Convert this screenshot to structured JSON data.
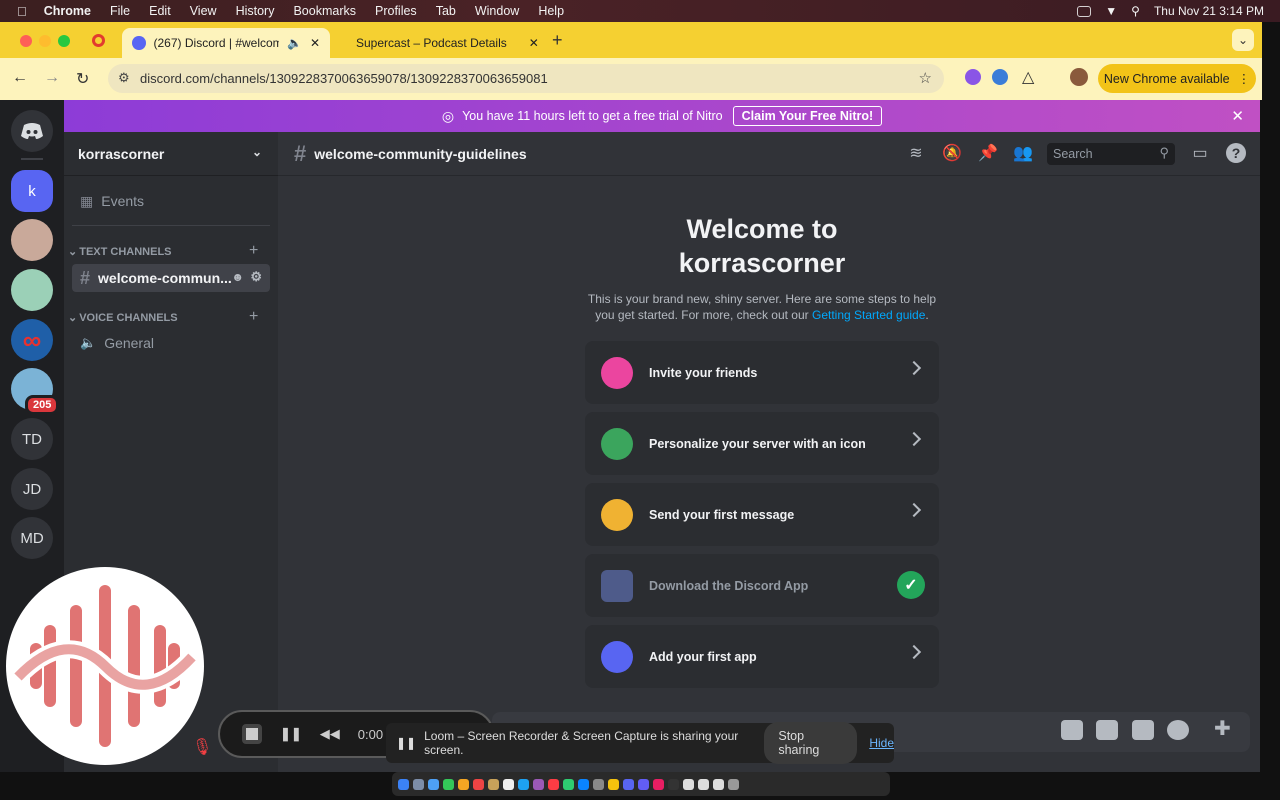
{
  "menubar": {
    "app": "Chrome",
    "items": [
      "File",
      "Edit",
      "View",
      "History",
      "Bookmarks",
      "Profiles",
      "Tab",
      "Window",
      "Help"
    ],
    "clock": "Thu Nov 21  3:14 PM"
  },
  "browser": {
    "tabs": [
      {
        "title": "(267) Discord | #welcome",
        "badge": "267"
      },
      {
        "title": "Supercast – Podcast Details"
      }
    ],
    "url": "discord.com/channels/1309228370063659078/1309228370063659081",
    "new_chrome": "New Chrome available"
  },
  "nitro": {
    "text": "You have 11 hours left to get a free trial of Nitro",
    "claim": "Claim Your Free Nitro!"
  },
  "guilds": {
    "selected_initial": "k",
    "badge": "205",
    "initials": [
      "TD",
      "JD",
      "MD"
    ]
  },
  "server": {
    "name": "korrascorner",
    "events": "Events",
    "text_category": "TEXT CHANNELS",
    "voice_category": "VOICE CHANNELS",
    "text_channel": "welcome-commun...",
    "voice_channel": "General"
  },
  "channel": {
    "name": "welcome-community-guidelines",
    "search_placeholder": "Search"
  },
  "welcome": {
    "title_line1": "Welcome to",
    "title_line2": "korrascorner",
    "desc": "This is your brand new, shiny server. Here are some steps to help you get started. For more, check out our",
    "link": "Getting Started guide",
    "cards": [
      "Invite your friends",
      "Personalize your server with an icon",
      "Send your first message",
      "Download the Discord App",
      "Add your first app"
    ]
  },
  "loom": {
    "time": "0:00",
    "share_text": "Loom – Screen Recorder & Screen Capture is sharing your screen.",
    "stop": "Stop sharing",
    "hide": "Hide"
  },
  "colors": {
    "accent": "#5865f2",
    "success": "#23a55a",
    "link": "#00a8fc",
    "nitro": "#a847d3"
  }
}
